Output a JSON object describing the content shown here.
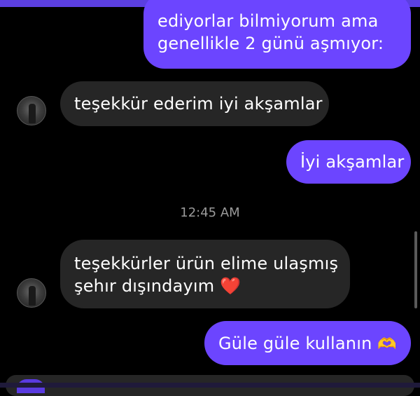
{
  "messages": [
    {
      "direction": "outgoing",
      "lines": [
        "ediyorlar bilmiyorum ama",
        "genellikle 2 günü aşmıyor:"
      ]
    },
    {
      "direction": "incoming",
      "text": "teşekkür ederim iyi akşamlar"
    },
    {
      "direction": "outgoing",
      "text": "İyi akşamlar"
    },
    {
      "direction": "incoming",
      "lines": [
        "teşekkürler ürün elime ulaşmış",
        "şehır dışındayım"
      ],
      "emoji": "❤️"
    },
    {
      "direction": "outgoing",
      "text": "Güle güle kullanın",
      "emoji": "🫶"
    }
  ],
  "timestamp": "12:45 AM",
  "colors": {
    "outgoing_bubble": "#6c45ff",
    "incoming_bubble": "#262626",
    "background": "#000000"
  }
}
